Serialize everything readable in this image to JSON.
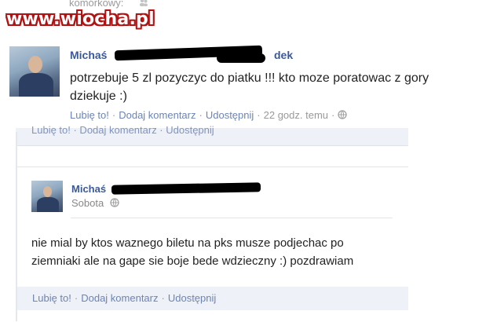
{
  "watermark": {
    "text": "www.wiocha.pl"
  },
  "header_leftover": {
    "text": "komórkowy:"
  },
  "post1": {
    "author": "Michaś",
    "author_suffix": "dek",
    "message_line1": "potrzebuje 5 zl pozyczyc do piatku !!! kto moze poratowac z gory",
    "message_line2": "dziekuje :)",
    "actions": {
      "like": "Lubię to!",
      "comment": "Dodaj komentarz",
      "share": "Udostępnij"
    },
    "timestamp": "22 godz. temu"
  },
  "obscured_strip": {
    "text": "Lubię to! · Dodaj komentarz · Udostępnij"
  },
  "post2": {
    "author": "Michaś",
    "date": "Sobota",
    "message_line1": "nie mial by ktos waznego biletu na pks musze podjechac po",
    "message_line2": "ziemniaki ale na gape sie boje bede wdzieczny :) pozdrawiam",
    "actions": {
      "like": "Lubię to!",
      "comment": "Dodaj komentarz",
      "share": "Udostępnij"
    }
  },
  "colors": {
    "link": "#3b5998",
    "action": "#6d84b4",
    "censor": "#000000",
    "watermark_outline": "#b31212"
  },
  "icons": [
    "globe-icon",
    "friends-icon"
  ]
}
